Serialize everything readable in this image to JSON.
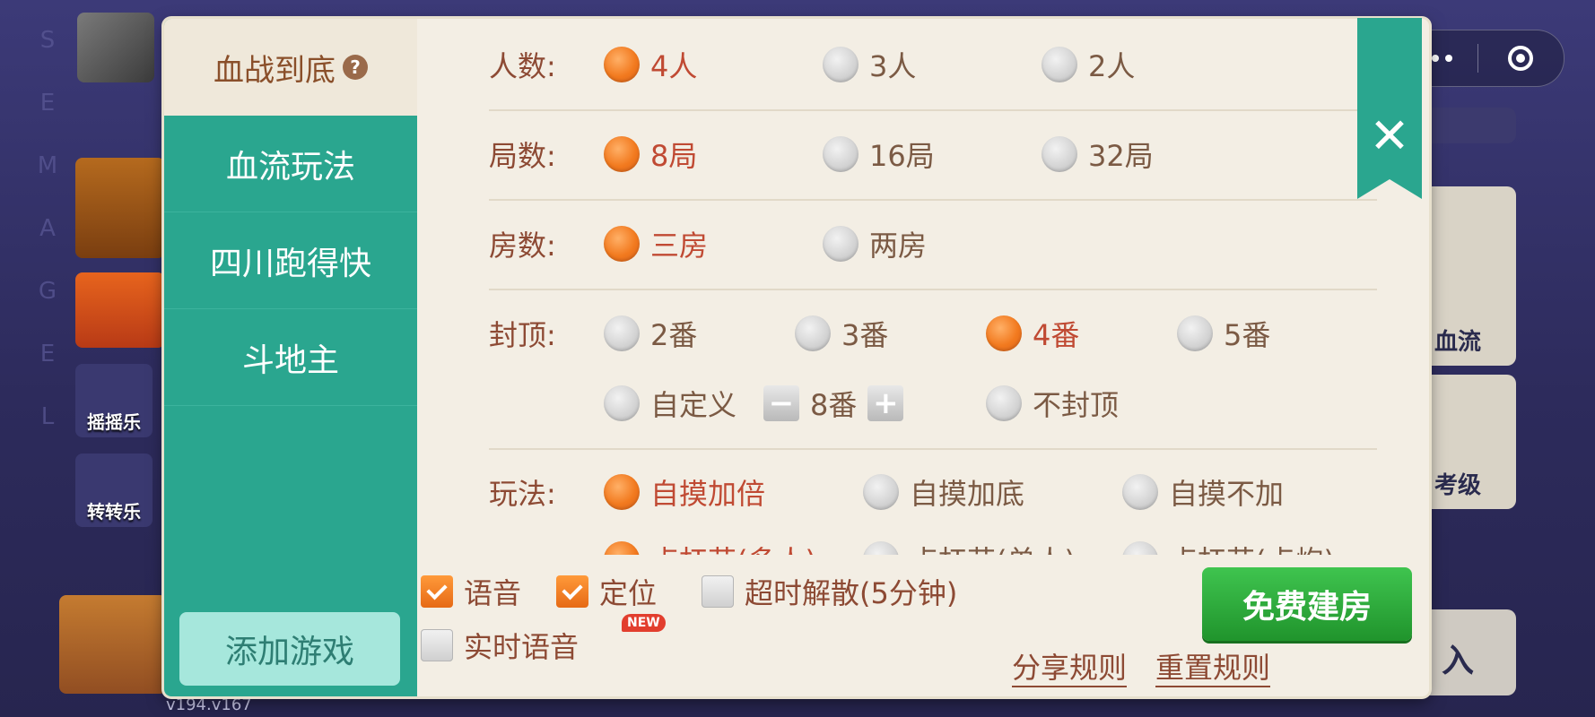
{
  "background": {
    "letters": [
      "S",
      "E",
      "M",
      "A",
      "G",
      "E",
      "L"
    ],
    "tiles": [
      {
        "caption": "摇摇乐"
      },
      {
        "caption": "转转乐"
      }
    ],
    "cards": [
      {
        "caption": "血流"
      },
      {
        "caption": "考级"
      },
      {
        "caption": "入"
      }
    ],
    "version": "v194.v167"
  },
  "dialog": {
    "sidebar": {
      "title": "血战到底",
      "help_icon": "question-icon",
      "items": [
        {
          "label": "血流玩法"
        },
        {
          "label": "四川跑得快"
        },
        {
          "label": "斗地主"
        }
      ],
      "add_game": "添加游戏"
    },
    "rows": {
      "players": {
        "label": "人数:",
        "options": [
          "4人",
          "3人",
          "2人"
        ],
        "selected": "4人"
      },
      "rounds": {
        "label": "局数:",
        "options": [
          "8局",
          "16局",
          "32局"
        ],
        "selected": "8局"
      },
      "rooms": {
        "label": "房数:",
        "options": [
          "三房",
          "两房"
        ],
        "selected": "三房"
      },
      "cap": {
        "label": "封顶:",
        "options": [
          "2番",
          "3番",
          "4番",
          "5番"
        ],
        "selected": "4番",
        "custom_label": "自定义",
        "custom_value": "8番",
        "no_cap": "不封顶"
      },
      "play": {
        "label": "玩法:",
        "options": [
          "自摸加倍",
          "自摸加底",
          "自摸不加"
        ],
        "selected": "自摸加倍",
        "cut_options": [
          "点杠花(多人)",
          "点杠花(单人)",
          "点杠花(点炮)"
        ]
      }
    },
    "bottom": {
      "voice": {
        "label": "语音",
        "checked": true
      },
      "location": {
        "label": "定位",
        "checked": true
      },
      "timeout": {
        "label": "超时解散(5分钟)",
        "checked": false
      },
      "realtime_voice": {
        "label": "实时语音",
        "checked": false,
        "badge": "NEW"
      },
      "create_button": "免费建房",
      "share_rules": "分享规则",
      "reset_rules": "重置规则"
    }
  }
}
